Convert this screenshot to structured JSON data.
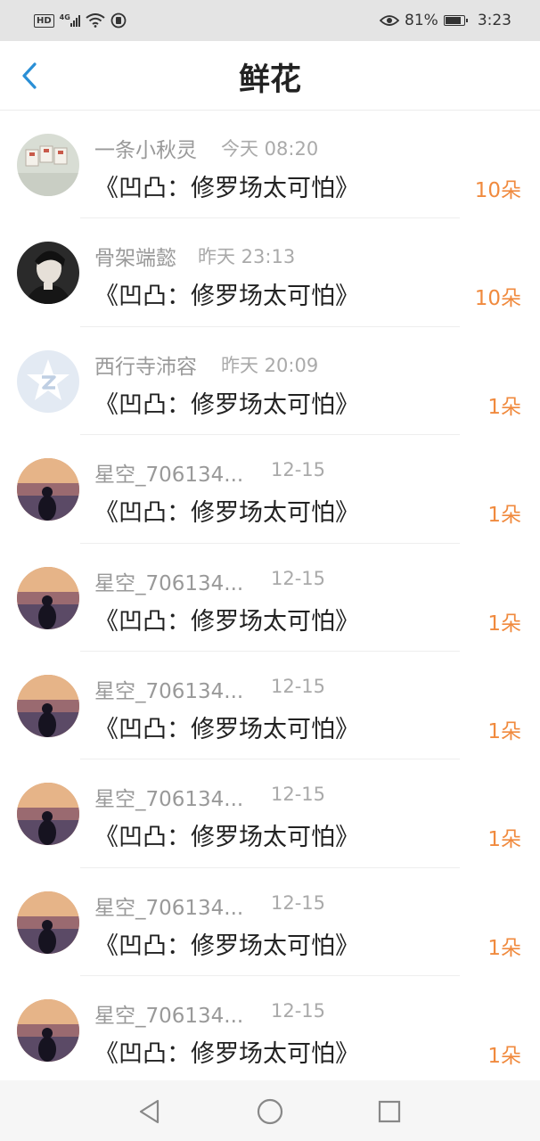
{
  "status_bar": {
    "hd": "HD",
    "network": "4G",
    "battery_percent": "81%",
    "time": "3:23",
    "icons": [
      "hd-badge-icon",
      "signal-icon",
      "wifi-icon",
      "notification-icon",
      "eye-icon",
      "battery-icon"
    ]
  },
  "header": {
    "title": "鲜花",
    "back_icon": "chevron-left-icon",
    "accent_color": "#2a8fd6"
  },
  "list": {
    "items": [
      {
        "user": "一条小秋灵",
        "time": "今天 08:20",
        "book": "《凹凸：修罗场太可怕》",
        "count": "10朵",
        "avatar": "avatar-cards"
      },
      {
        "user": "骨架端懿",
        "time": "昨天 23:13",
        "book": "《凹凸：修罗场太可怕》",
        "count": "10朵",
        "avatar": "avatar-portrait"
      },
      {
        "user": "西行寺沛容",
        "time": "昨天 20:09",
        "book": "《凹凸：修罗场太可怕》",
        "count": "1朵",
        "avatar": "avatar-default"
      },
      {
        "user": "星空_706134...",
        "time": "12-15",
        "book": "《凹凸：修罗场太可怕》",
        "count": "1朵",
        "avatar": "avatar-sunset"
      },
      {
        "user": "星空_706134...",
        "time": "12-15",
        "book": "《凹凸：修罗场太可怕》",
        "count": "1朵",
        "avatar": "avatar-sunset"
      },
      {
        "user": "星空_706134...",
        "time": "12-15",
        "book": "《凹凸：修罗场太可怕》",
        "count": "1朵",
        "avatar": "avatar-sunset"
      },
      {
        "user": "星空_706134...",
        "time": "12-15",
        "book": "《凹凸：修罗场太可怕》",
        "count": "1朵",
        "avatar": "avatar-sunset"
      },
      {
        "user": "星空_706134...",
        "time": "12-15",
        "book": "《凹凸：修罗场太可怕》",
        "count": "1朵",
        "avatar": "avatar-sunset"
      },
      {
        "user": "星空_706134...",
        "time": "12-15",
        "book": "《凹凸：修罗场太可怕》",
        "count": "1朵",
        "avatar": "avatar-sunset"
      }
    ],
    "count_color": "#f08a3e"
  },
  "nav_bar": {
    "icons": [
      "back-triangle-icon",
      "home-circle-icon",
      "recents-square-icon"
    ]
  }
}
